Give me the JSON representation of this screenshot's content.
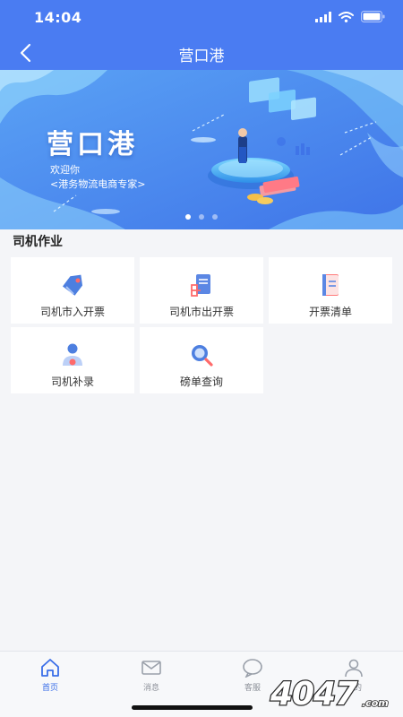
{
  "status_bar": {
    "time": "14:04"
  },
  "header": {
    "title": "营口港"
  },
  "banner": {
    "title": "营口港",
    "welcome": "欢迎你",
    "subtitle": "<港务物流电商专家>",
    "active_slide": 1,
    "slide_count": 3
  },
  "section": {
    "title": "司机作业"
  },
  "tiles": [
    {
      "label": "司机市入开票",
      "icon": "tag-icon"
    },
    {
      "label": "司机市出开票",
      "icon": "document-export-icon"
    },
    {
      "label": "开票清单",
      "icon": "list-icon"
    },
    {
      "label": "司机补录",
      "icon": "user-icon"
    },
    {
      "label": "磅单查询",
      "icon": "search-icon"
    }
  ],
  "tabs": [
    {
      "label": "首页",
      "icon": "home-icon",
      "active": true
    },
    {
      "label": "消息",
      "icon": "mail-icon",
      "active": false
    },
    {
      "label": "客服",
      "icon": "chat-icon",
      "active": false
    },
    {
      "label": "我的",
      "icon": "profile-icon",
      "active": false
    }
  ],
  "watermark": {
    "text": "4047.com"
  },
  "colors": {
    "primary": "#4a7cf2",
    "background": "#f4f5f8",
    "tab_active": "#3a6ee8",
    "tab_inactive": "#8d9199"
  }
}
